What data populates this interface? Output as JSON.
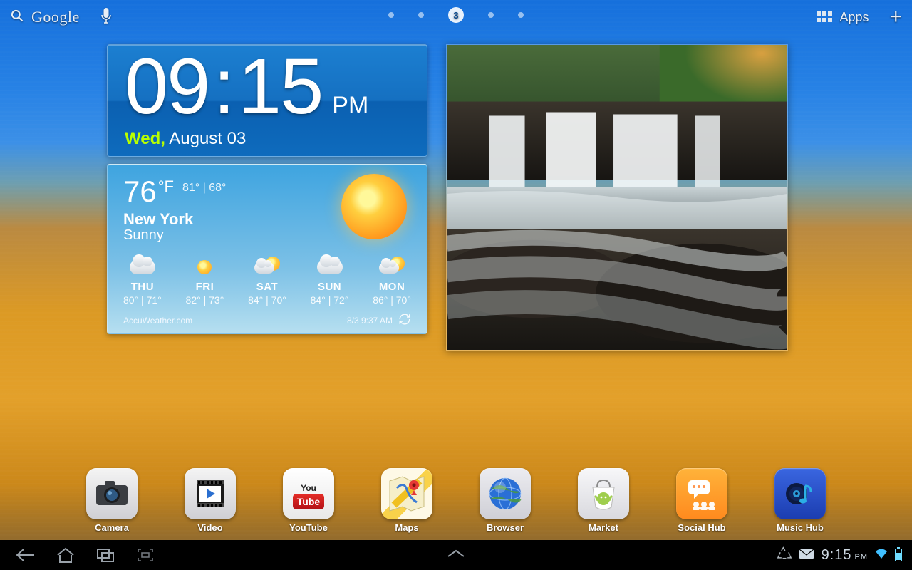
{
  "topbar": {
    "search_label": "Google",
    "apps_label": "Apps",
    "active_page_index": 2,
    "active_page_number": "3",
    "page_count": 5
  },
  "clock": {
    "hours": "09",
    "minutes": "15",
    "ampm": "PM",
    "day_of_week": "Wed,",
    "month_day": "August 03"
  },
  "weather": {
    "temp_value": "76",
    "temp_unit": "°F",
    "high": "81°",
    "low": "68°",
    "location": "New York",
    "condition": "Sunny",
    "provider": "AccuWeather.com",
    "updated": "8/3 9:37 AM",
    "days": [
      {
        "name": "THU",
        "hi": "80°",
        "lo": "71°",
        "icon": "cloudy"
      },
      {
        "name": "FRI",
        "hi": "82°",
        "lo": "73°",
        "icon": "sunny"
      },
      {
        "name": "SAT",
        "hi": "84°",
        "lo": "70°",
        "icon": "mix"
      },
      {
        "name": "SUN",
        "hi": "84°",
        "lo": "72°",
        "icon": "cloudy"
      },
      {
        "name": "MON",
        "hi": "86°",
        "lo": "70°",
        "icon": "mix"
      }
    ]
  },
  "dock": [
    {
      "name": "Camera",
      "id": "camera"
    },
    {
      "name": "Video",
      "id": "video"
    },
    {
      "name": "YouTube",
      "id": "youtube"
    },
    {
      "name": "Maps",
      "id": "maps"
    },
    {
      "name": "Browser",
      "id": "browser"
    },
    {
      "name": "Market",
      "id": "market"
    },
    {
      "name": "Social Hub",
      "id": "socialhub"
    },
    {
      "name": "Music Hub",
      "id": "musichub"
    }
  ],
  "sysbar": {
    "clock_hhmm": "9:15",
    "clock_ampm": "PM"
  }
}
